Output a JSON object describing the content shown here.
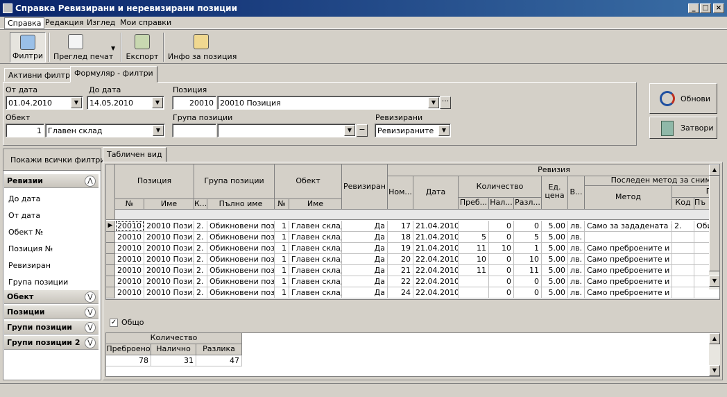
{
  "window": {
    "title": "Справка Ревизирани и неревизирани позиции"
  },
  "menu": [
    "Справка",
    "Редакция",
    "Изглед",
    "Мои справки"
  ],
  "toolbar": {
    "filters": "Филтри",
    "preview": "Преглед печат",
    "export": "Експорт",
    "info": "Инфо за позиция"
  },
  "tabs": {
    "active": "Активни филтри",
    "form": "Формуляр - филтри",
    "table": "Табличен вид"
  },
  "form": {
    "from_date_label": "От дата",
    "from_date": "01.04.2010",
    "to_date_label": "До дата",
    "to_date": "14.05.2010",
    "position_label": "Позиция",
    "position_code": "20010",
    "position_name": "20010 Позиция",
    "object_label": "Обект",
    "object_code": "1",
    "object_name": "Главен склад",
    "group_label": "Група позиции",
    "group_code": "",
    "group_name": "",
    "revised_label": "Ревизирани",
    "revised_value": "Ревизираните"
  },
  "actions": {
    "refresh": "Обнови",
    "close": "Затвори"
  },
  "sidebar": {
    "show_all": "Покажи всички филтри",
    "sections": [
      {
        "label": "Ревизии",
        "items": [
          "До дата",
          "От дата",
          "Обект №",
          "Позиция №",
          "Ревизиран",
          "Група позиции"
        ]
      },
      {
        "label": "Обект"
      },
      {
        "label": "Позиции"
      },
      {
        "label": "Групи позиции"
      },
      {
        "label": "Групи позиции 2"
      }
    ]
  },
  "grid": {
    "h_revision": "Ревизия",
    "h_position": "Позиция",
    "h_group": "Група позиции",
    "h_object": "Обект",
    "h_revised": "Ревизиран",
    "h_num": "Ном...",
    "h_date": "Дата",
    "h_qty": "Количество",
    "h_unit": "Ед. цена",
    "h_cur": "В...",
    "h_lastmethod": "Последен метод за снимка",
    "h_method": "Метод",
    "h_grp2": "Гру",
    "sub_no": "№",
    "sub_name": "Име",
    "sub_k": "К...",
    "sub_fullname": "Пълно име",
    "sub_objno": "№",
    "sub_objname": "Име",
    "sub_counted": "Преб...",
    "sub_avail": "Нал...",
    "sub_diff": "Разл...",
    "sub_code": "Код",
    "sub_p": "Пъ",
    "rows": [
      [
        "20010",
        "20010 Пози...",
        "2.",
        "Обикновени поз...",
        "1",
        "Главен склад",
        "Да",
        "17",
        "21.04.2010",
        "",
        "0",
        "0",
        "5.00",
        "лв.",
        "Само за зададената г...",
        "2.",
        "Оби"
      ],
      [
        "20010",
        "20010 Пози...",
        "2.",
        "Обикновени поз...",
        "1",
        "Главен склад",
        "Да",
        "18",
        "21.04.2010",
        "5",
        "0",
        "5",
        "5.00",
        "лв.",
        "",
        "",
        ""
      ],
      [
        "20010",
        "20010 Пози...",
        "2.",
        "Обикновени поз...",
        "1",
        "Главен склад",
        "Да",
        "19",
        "21.04.2010",
        "11",
        "10",
        "1",
        "5.00",
        "лв.",
        "Само преброените и о...",
        "",
        ""
      ],
      [
        "20010",
        "20010 Пози...",
        "2.",
        "Обикновени поз...",
        "1",
        "Главен склад",
        "Да",
        "20",
        "22.04.2010",
        "10",
        "0",
        "10",
        "5.00",
        "лв.",
        "Само преброените и о...",
        "",
        ""
      ],
      [
        "20010",
        "20010 Пози...",
        "2.",
        "Обикновени поз...",
        "1",
        "Главен склад",
        "Да",
        "21",
        "22.04.2010",
        "11",
        "0",
        "11",
        "5.00",
        "лв.",
        "Само преброените и о...",
        "",
        ""
      ],
      [
        "20010",
        "20010 Пози...",
        "2.",
        "Обикновени поз...",
        "1",
        "Главен склад",
        "Да",
        "22",
        "22.04.2010",
        "",
        "0",
        "0",
        "5.00",
        "лв.",
        "Само преброените и о...",
        "",
        ""
      ],
      [
        "20010",
        "20010 Пози...",
        "2.",
        "Обикновени поз...",
        "1",
        "Главен склад",
        "Да",
        "24",
        "22.04.2010",
        "",
        "0",
        "0",
        "5.00",
        "лв.",
        "Само преброените и о...",
        "",
        ""
      ]
    ]
  },
  "total": {
    "checkbox": "Общо",
    "qty": "Количество",
    "counted_h": "Преброено",
    "avail_h": "Налично",
    "diff_h": "Разлика",
    "counted": "78",
    "avail": "31",
    "diff": "47"
  }
}
